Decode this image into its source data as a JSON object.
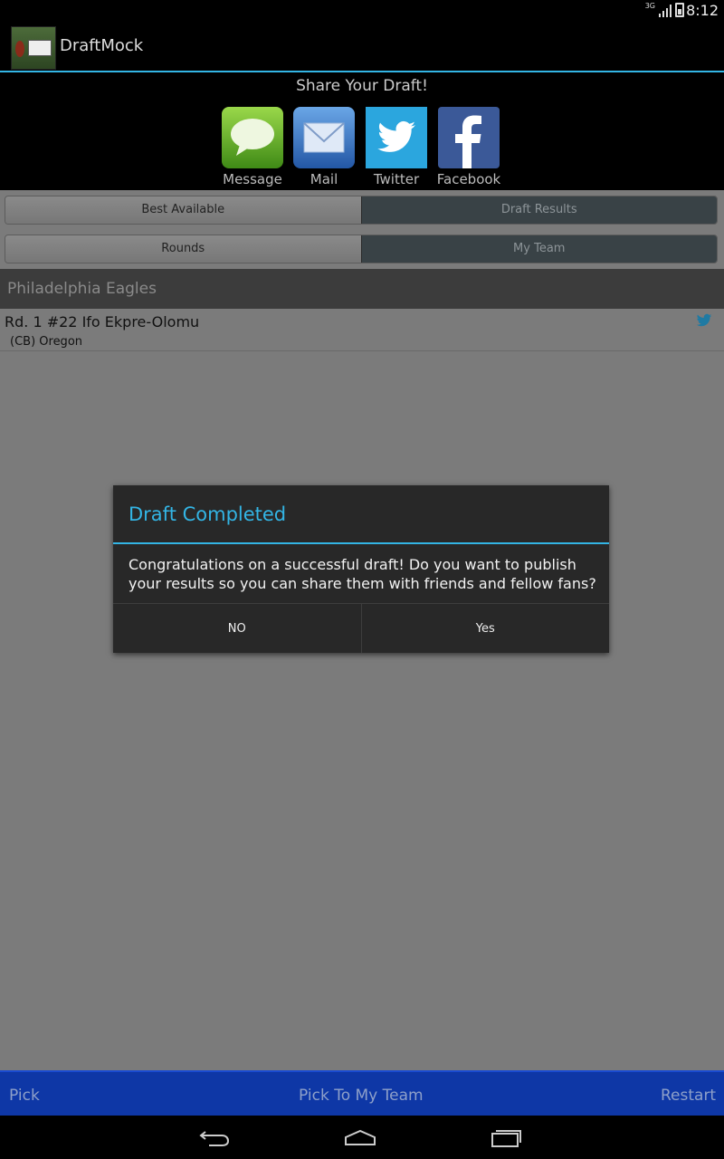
{
  "status_bar": {
    "network": "3G",
    "time": "8:12"
  },
  "action_bar": {
    "title": "DraftMock"
  },
  "share": {
    "title": "Share Your Draft!",
    "buttons": [
      {
        "label": "Message",
        "icon": "message-bubble-icon"
      },
      {
        "label": "Mail",
        "icon": "mail-envelope-icon"
      },
      {
        "label": "Twitter",
        "icon": "twitter-bird-icon"
      },
      {
        "label": "Facebook",
        "icon": "facebook-f-icon"
      }
    ]
  },
  "tabs_top": {
    "left": "Best Available",
    "right": "Draft Results",
    "selected": "Draft Results"
  },
  "tabs_bottom": {
    "left": "Rounds",
    "right": "My Team",
    "selected": "My Team"
  },
  "team": {
    "name": "Philadelphia Eagles"
  },
  "picks": [
    {
      "title": "Rd. 1 #22 Ifo Ekpre-Olomu",
      "subtitle": "(CB) Oregon",
      "icon": "twitter-bird-icon"
    }
  ],
  "dialog": {
    "title": "Draft Completed",
    "message": "Congratulations on a successful draft! Do you want to publish your results so you can share them with friends and fellow fans?",
    "negative": "NO",
    "positive": "Yes"
  },
  "bottom_bar": {
    "pick": "Pick",
    "pick_to_team": "Pick To My Team",
    "restart": "Restart"
  },
  "colors": {
    "accent": "#33b5e5",
    "bottom_bar": "#0e37a6",
    "twitter": "#2ba6de",
    "facebook": "#3b5998"
  }
}
